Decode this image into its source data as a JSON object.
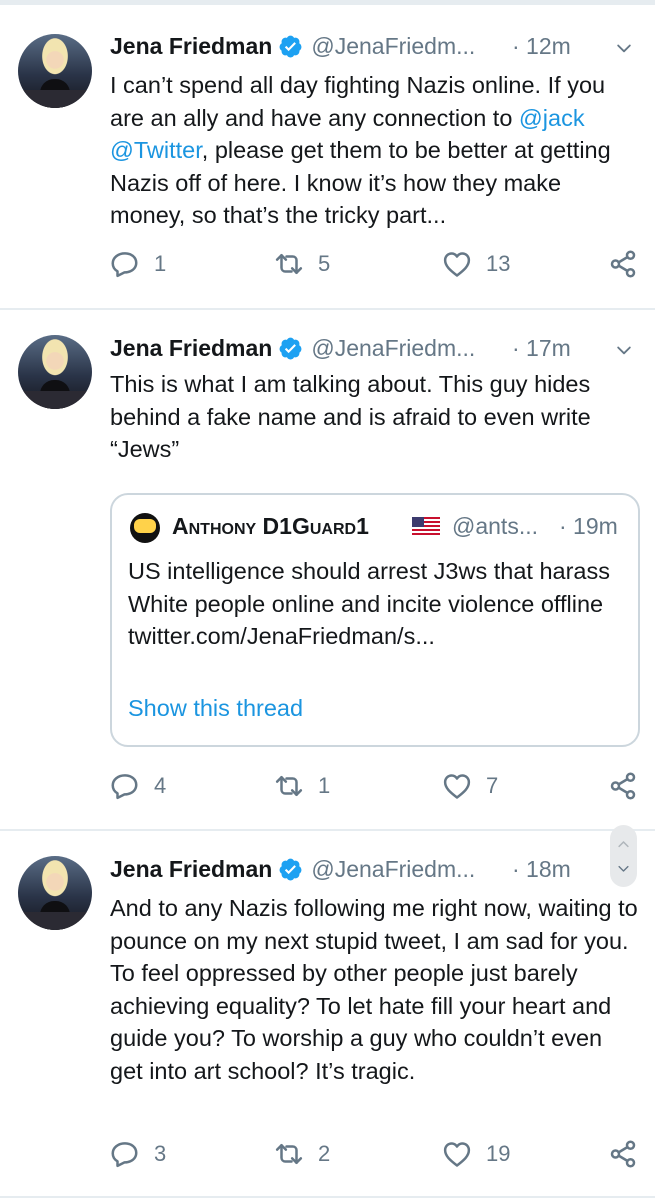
{
  "tweets": [
    {
      "author": "Jena Friedman",
      "handle": "@JenaFriedm...",
      "time": "· 12m",
      "text_parts": [
        "I can’t spend all day fighting Nazis online. If you are an ally and have any connection to ",
        "@jack",
        " ",
        "@Twitter",
        ", please get them to be better at getting Nazis off of here. I know it’s how they make money, so that’s the tricky part..."
      ],
      "replies": "1",
      "retweets": "5",
      "likes": "13"
    },
    {
      "author": "Jena Friedman",
      "handle": "@JenaFriedm...",
      "time": "· 17m",
      "text": "This is what I am talking about. This guy hides behind a fake name and is afraid to even write “Jews”",
      "quote": {
        "author": "Anthony D1Guard1",
        "handle": "@ants...",
        "time": "· 19m",
        "text": "US intelligence should arrest J3ws that harass White people online and incite violence offline twitter.com/JenaFriedman/s...",
        "link": "Show this thread"
      },
      "replies": "4",
      "retweets": "1",
      "likes": "7"
    },
    {
      "author": "Jena Friedman",
      "handle": "@JenaFriedm...",
      "time": "· 18m",
      "text": "And to any Nazis following me right now, waiting to pounce on my next stupid tweet, I am sad for you. To feel oppressed by other people just barely achieving equality? To let hate fill your heart and guide you? To worship a guy who couldn’t even get into art school? It’s tragic.",
      "replies": "3",
      "retweets": "2",
      "likes": "19"
    }
  ],
  "icons": {
    "verified": "verified-badge-icon",
    "menu": "chevron-down-icon",
    "reply": "reply-icon",
    "retweet": "retweet-icon",
    "like": "heart-icon",
    "share": "share-icon",
    "flag": "us-flag-icon"
  },
  "colors": {
    "accent": "#1b95e0",
    "text": "#14171a",
    "secondary": "#657786",
    "border": "#ccd6dd",
    "separator": "#e6ecf0"
  }
}
